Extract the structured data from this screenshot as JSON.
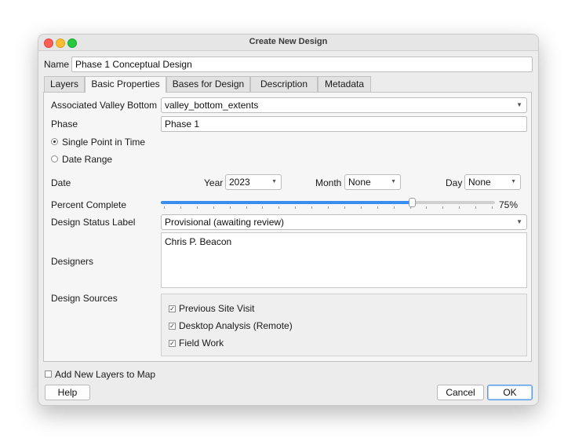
{
  "window": {
    "title": "Create New Design"
  },
  "name_field": {
    "label": "Name",
    "value": "Phase 1 Conceptual Design"
  },
  "tabs": [
    {
      "label": "Layers",
      "active": false
    },
    {
      "label": "Basic Properties",
      "active": true
    },
    {
      "label": "Bases for Design",
      "active": false
    },
    {
      "label": "Description",
      "active": false
    },
    {
      "label": "Metadata",
      "active": false
    }
  ],
  "basic": {
    "valley_bottom": {
      "label": "Associated Valley Bottom",
      "value": "valley_bottom_extents"
    },
    "phase": {
      "label": "Phase",
      "value": "Phase 1"
    },
    "time_mode": {
      "single_label": "Single Point in Time",
      "range_label": "Date Range",
      "selected": "single"
    },
    "date": {
      "label": "Date",
      "year_label": "Year",
      "year_value": "2023",
      "month_label": "Month",
      "month_value": "None",
      "day_label": "Day",
      "day_value": "None"
    },
    "percent_complete": {
      "label": "Percent Complete",
      "value": 75,
      "value_text": "75%"
    },
    "status": {
      "label": "Design Status Label",
      "value": "Provisional (awaiting review)"
    },
    "designers": {
      "label": "Designers",
      "value": "Chris P. Beacon"
    },
    "sources": {
      "label": "Design Sources",
      "items": [
        {
          "label": "Previous Site Visit",
          "checked": true
        },
        {
          "label": "Desktop Analysis (Remote)",
          "checked": true
        },
        {
          "label": "Field Work",
          "checked": true
        }
      ]
    }
  },
  "add_layers": {
    "label": "Add New Layers to Map",
    "checked": false
  },
  "buttons": {
    "help": "Help",
    "cancel": "Cancel",
    "ok": "OK"
  },
  "icons": {
    "dropdown": "chevron-down-icon",
    "check": "checkmark-icon"
  },
  "colors": {
    "accent": "#3b8ef0",
    "close": "#fe5f57",
    "minimize": "#febc2e",
    "zoom": "#28c840"
  }
}
